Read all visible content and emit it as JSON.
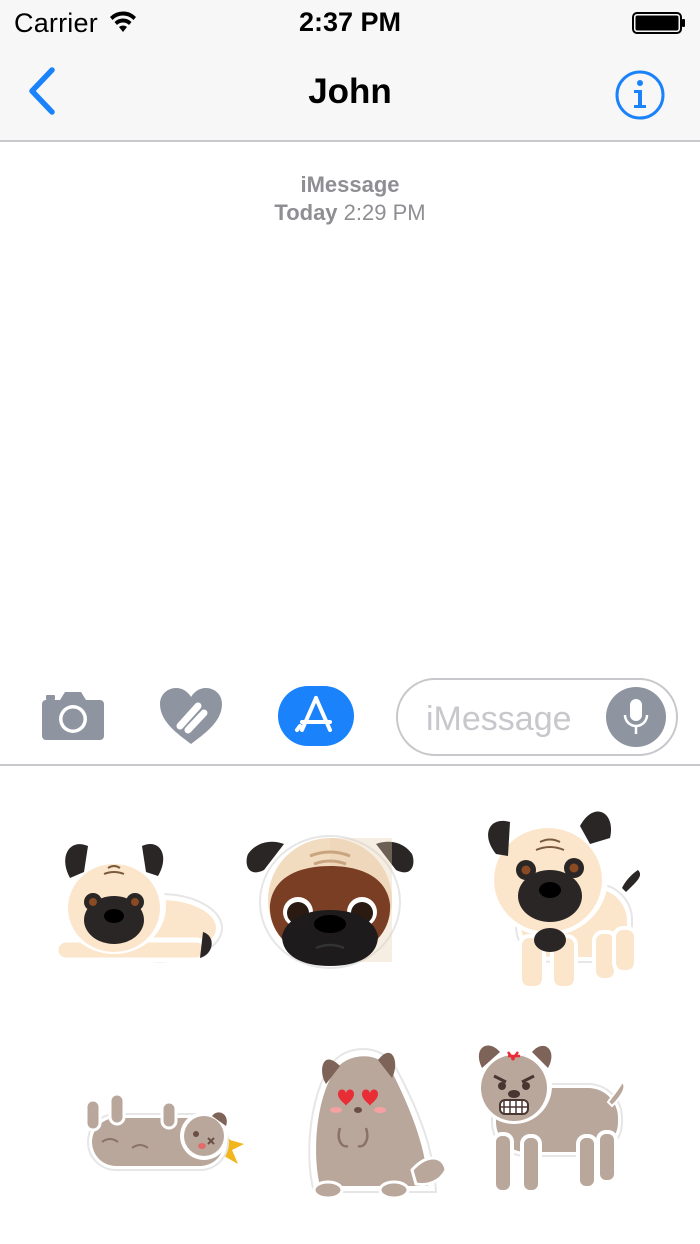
{
  "status_bar": {
    "carrier": "Carrier",
    "time": "2:37 PM",
    "icons": [
      "wifi-icon",
      "battery-icon"
    ]
  },
  "nav": {
    "title": "John",
    "back_icon": "chevron-left-icon",
    "info_icon": "info-icon",
    "accent_color": "#1a82fb"
  },
  "conversation": {
    "service": "iMessage",
    "timestamp_day": "Today",
    "timestamp_time": "2:29 PM"
  },
  "input_bar": {
    "camera_icon": "camera-icon",
    "digital_touch_icon": "digital-touch-heart-icon",
    "app_store_icon": "app-store-icon",
    "placeholder": "iMessage",
    "mic_icon": "microphone-icon"
  },
  "stickers": [
    {
      "name": "pug-lying-down",
      "color": "#fbe6cc"
    },
    {
      "name": "pug-face",
      "color": "#f2dcc0"
    },
    {
      "name": "pug-standing",
      "color": "#fbe6cc"
    },
    {
      "name": "brown-pug-knocked-out",
      "color": "#b9a79c"
    },
    {
      "name": "brown-pug-in-love",
      "color": "#b9a79c"
    },
    {
      "name": "brown-pug-angry",
      "color": "#b9a79c"
    }
  ]
}
